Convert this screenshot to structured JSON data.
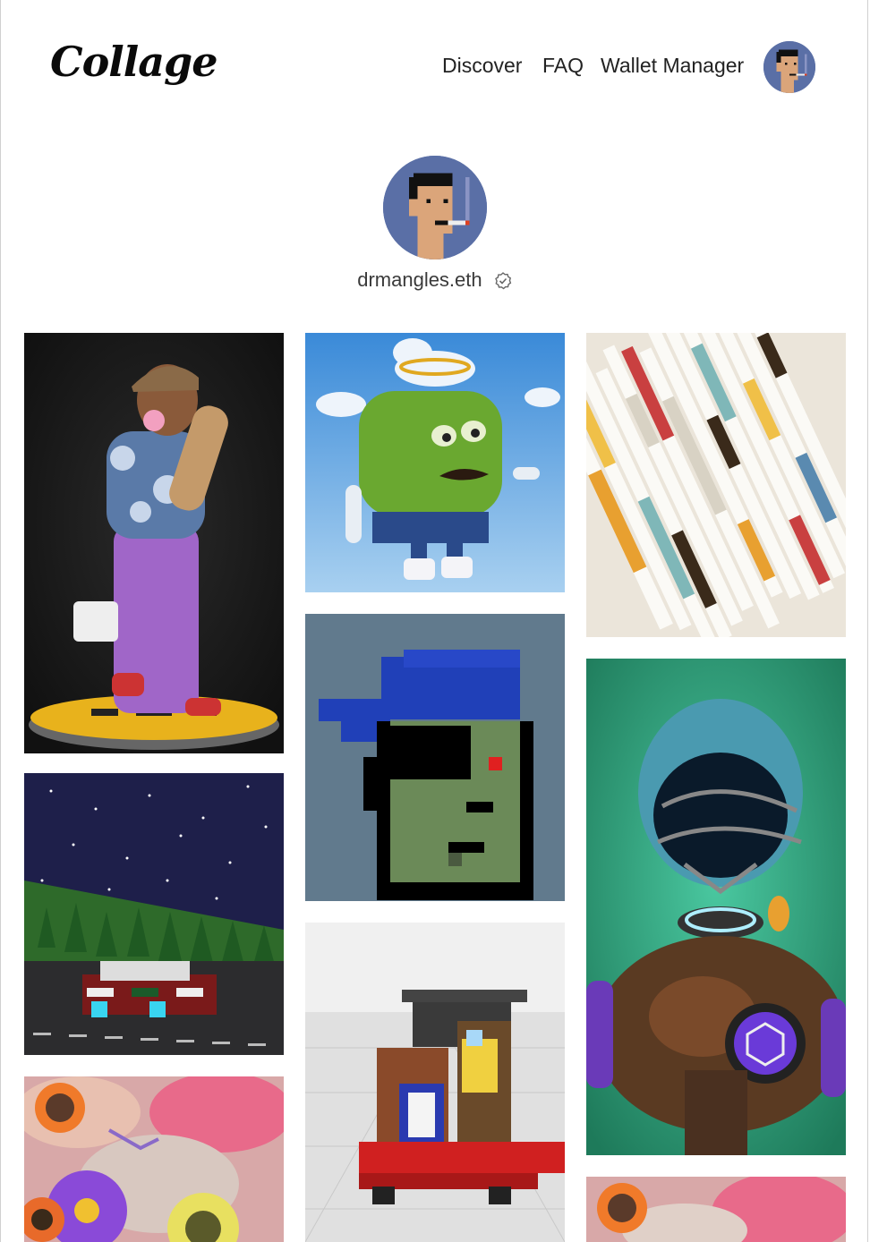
{
  "header": {
    "logo": "Collage",
    "nav": [
      {
        "label": "Discover"
      },
      {
        "label": "FAQ"
      },
      {
        "label": "Wallet Manager"
      }
    ]
  },
  "profile": {
    "username": "drmangles.eth",
    "verified": true
  },
  "gallery": {
    "items": [
      {
        "name": "skater-character-art"
      },
      {
        "name": "green-mustache-character-art"
      },
      {
        "name": "abstract-stripes-art"
      },
      {
        "name": "pixel-zombie-punk-art"
      },
      {
        "name": "voxel-car-night-art"
      },
      {
        "name": "voxel-character-art"
      },
      {
        "name": "robot-football-helmet-art"
      },
      {
        "name": "flowers-art"
      },
      {
        "name": "flowers-art-2"
      }
    ]
  },
  "colors": {
    "avatar_bg": "#5a6fa6",
    "text": "#1a1a1a"
  }
}
